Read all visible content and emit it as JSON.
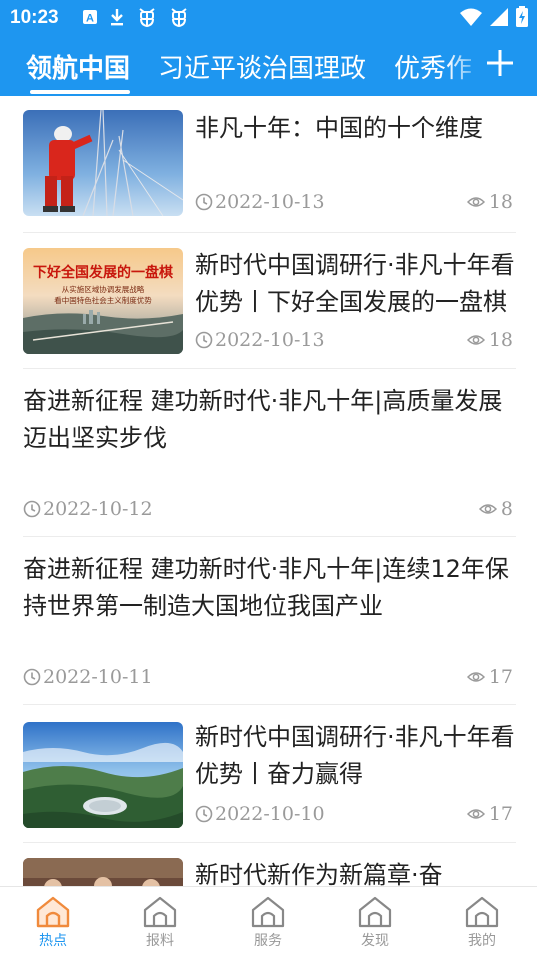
{
  "status": {
    "time": "10:23"
  },
  "tabs": [
    {
      "label": "领航中国",
      "active": true
    },
    {
      "label": "习近平谈治国理政",
      "active": false
    },
    {
      "label": "优秀作",
      "active": false
    }
  ],
  "feed": [
    {
      "title": "非凡十年：中国的十个维度",
      "date": "2022-10-13",
      "views": "18",
      "thumbnail": "climber-on-tower"
    },
    {
      "title": "新时代中国调研行·非凡十年看优势丨下好全国发展的一盘棋",
      "date": "2022-10-13",
      "views": "18",
      "thumbnail": "aerial-city-banner",
      "thumb_text": {
        "headline": "下好全国发展的一盘棋",
        "line1": "从实施区域协调发展战略",
        "line2": "看中国特色社会主义制度优势"
      }
    },
    {
      "title": "奋进新征程  建功新时代·非凡十年|高质量发展迈出坚实步伐",
      "date": "2022-10-12",
      "views": "8"
    },
    {
      "title": "奋进新征程  建功新时代·非凡十年|连续12年保持世界第一制造大国地位我国产业",
      "date": "2022-10-11",
      "views": "17"
    },
    {
      "title": "新时代中国调研行·非凡十年看优势丨奋力赢得",
      "date": "2022-10-10",
      "views": "17",
      "thumbnail": "radio-telescope-valley"
    },
    {
      "title": "新时代新作为新篇章·奋",
      "thumbnail": "people-indoor"
    }
  ],
  "bottom_nav": [
    {
      "label": "热点",
      "icon": "home-icon",
      "active": true
    },
    {
      "label": "报料",
      "icon": "home-icon",
      "active": false
    },
    {
      "label": "服务",
      "icon": "home-icon",
      "active": false
    },
    {
      "label": "发现",
      "icon": "home-icon",
      "active": false
    },
    {
      "label": "我的",
      "icon": "home-icon",
      "active": false
    }
  ],
  "colors": {
    "primary": "#1e96f0",
    "meta_text": "#9a9a9a",
    "title_text": "#222222"
  }
}
